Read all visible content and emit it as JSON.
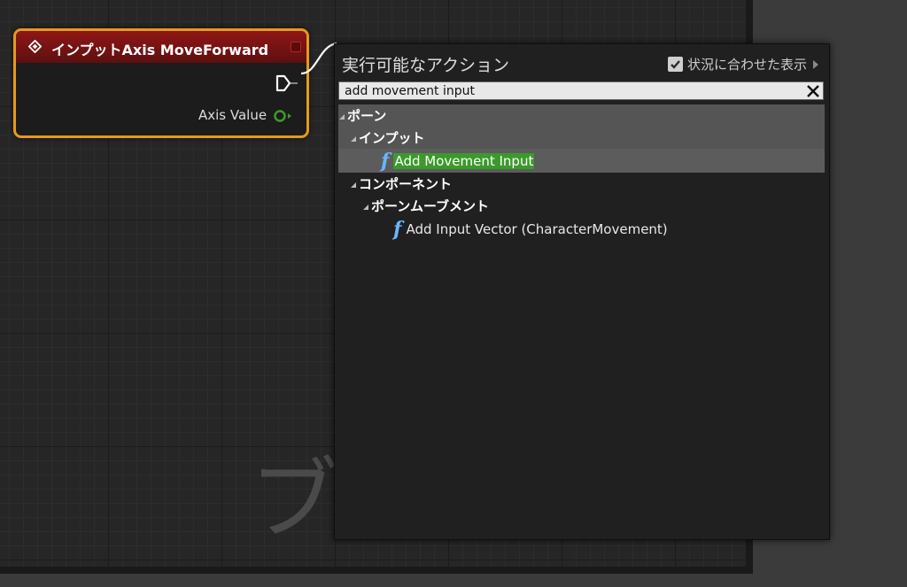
{
  "graph": {
    "watermark": "ブ"
  },
  "node": {
    "title": "インプットAxis MoveForward",
    "axis_label": "Axis Value",
    "header_color": "#8f1616",
    "border_color": "#e59a1c"
  },
  "popup": {
    "title": "実行可能なアクション",
    "context_label": "状況に合わせた表示",
    "context_checked": true,
    "search_value": "add movement input",
    "tree": {
      "pawn": "ポーン",
      "input": "インプット",
      "add_movement_input": "Add Movement Input",
      "component": "コンポーネント",
      "pawn_movement": "ポーンムーブメント",
      "add_input_vector": "Add Input Vector (CharacterMovement)"
    },
    "highlight_color": "#3a9a2a",
    "function_icon_glyph": "f"
  }
}
